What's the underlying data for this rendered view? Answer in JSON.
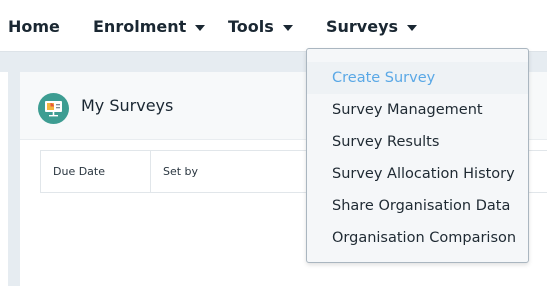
{
  "nav": {
    "home": "Home",
    "enrolment": "Enrolment",
    "tools": "Tools",
    "surveys": "Surveys"
  },
  "panel": {
    "title": "My Surveys",
    "icon": "presentation-board-icon",
    "table_headers": [
      "Due Date",
      "Set by"
    ]
  },
  "surveys_menu": {
    "items": [
      "Create Survey",
      "Survey Management",
      "Survey Results",
      "Survey Allocation History",
      "Share Organisation Data",
      "Organisation Comparison"
    ],
    "highlighted": "Create Survey"
  },
  "colors": {
    "accent_teal": "#3d9d92",
    "link_highlight": "#5aa8e6",
    "page_background": "#e6ecf1"
  }
}
